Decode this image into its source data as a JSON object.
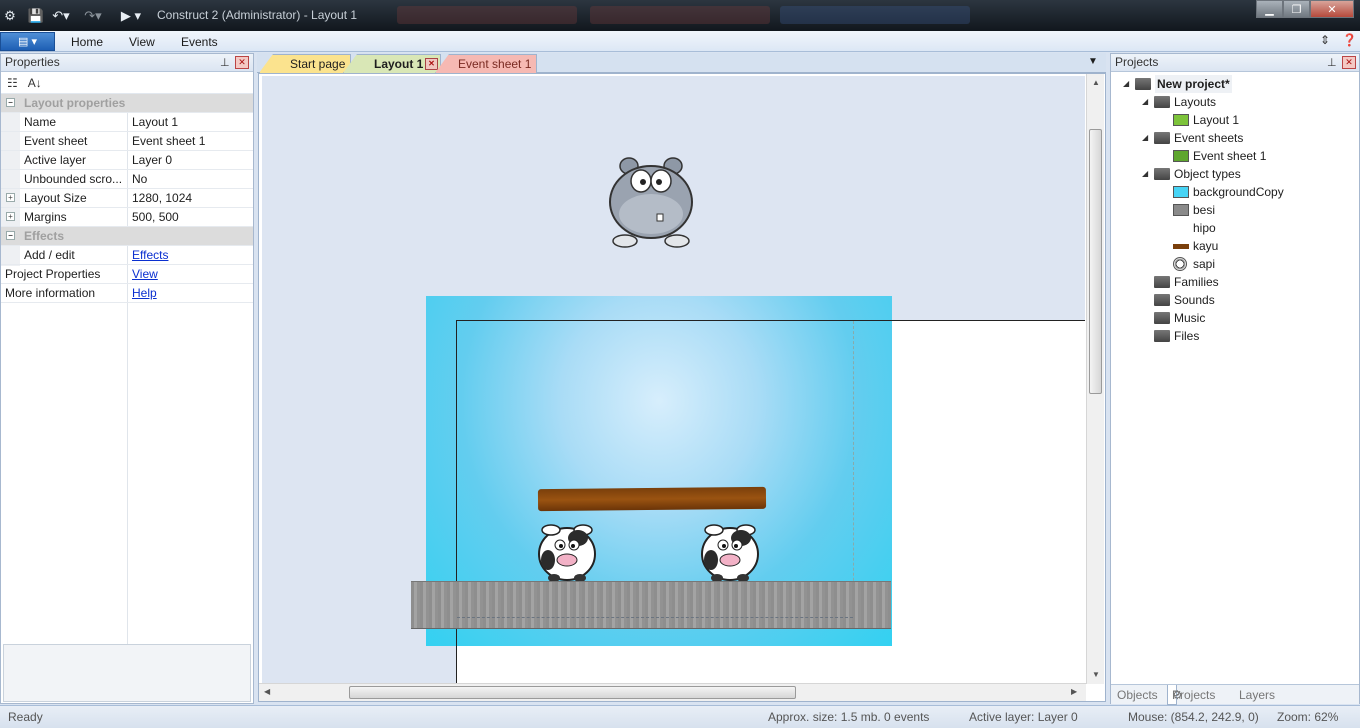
{
  "window": {
    "title": "Construct 2 (Administrator) - Layout 1"
  },
  "ribbon": {
    "tabs": [
      "Home",
      "View",
      "Events"
    ]
  },
  "properties": {
    "title": "Properties",
    "rows": [
      {
        "type": "category",
        "label": "Layout properties"
      },
      {
        "key": "Name",
        "value": "Layout 1"
      },
      {
        "key": "Event sheet",
        "value": "Event sheet 1"
      },
      {
        "key": "Active layer",
        "value": "Layer 0"
      },
      {
        "key": "Unbounded scro...",
        "value": "No"
      },
      {
        "key": "Layout Size",
        "value": "1280, 1024",
        "expandable": true
      },
      {
        "key": "Margins",
        "value": "500, 500",
        "expandable": true
      },
      {
        "type": "category",
        "label": "Effects"
      },
      {
        "key": "Add / edit",
        "value": "Effects",
        "link": true
      },
      {
        "key": "Project Properties",
        "value": "View",
        "link": true,
        "top": true
      },
      {
        "key": "More information",
        "value": "Help",
        "link": true,
        "top": true
      }
    ]
  },
  "doc_tabs": [
    {
      "label": "Start page",
      "color": "#fbe38e"
    },
    {
      "label": "Layout 1",
      "color": "#d9e7b6",
      "active": true
    },
    {
      "label": "Event sheet 1",
      "color": "#f6b9b3"
    }
  ],
  "projects": {
    "title": "Projects",
    "tree": [
      {
        "label": "New project*",
        "level": 0,
        "kind": "project",
        "bold": true
      },
      {
        "label": "Layouts",
        "level": 1,
        "kind": "folder"
      },
      {
        "label": "Layout 1",
        "level": 2,
        "kind": "layout",
        "color": "#7cc33a"
      },
      {
        "label": "Event sheets",
        "level": 1,
        "kind": "folder"
      },
      {
        "label": "Event sheet 1",
        "level": 2,
        "kind": "eventsheet",
        "color": "#5ea62e"
      },
      {
        "label": "Object types",
        "level": 1,
        "kind": "folder"
      },
      {
        "label": "backgroundCopy",
        "level": 2,
        "kind": "swatch",
        "color": "#47d4f5"
      },
      {
        "label": "besi",
        "level": 2,
        "kind": "swatch",
        "color": "#8a8a8a"
      },
      {
        "label": "hipo",
        "level": 2,
        "kind": "none"
      },
      {
        "label": "kayu",
        "level": 2,
        "kind": "swatch",
        "color": "#7a3f0b"
      },
      {
        "label": "sapi",
        "level": 2,
        "kind": "cow"
      },
      {
        "label": "Families",
        "level": 1,
        "kind": "folder"
      },
      {
        "label": "Sounds",
        "level": 1,
        "kind": "folder"
      },
      {
        "label": "Music",
        "level": 1,
        "kind": "folder"
      },
      {
        "label": "Files",
        "level": 1,
        "kind": "folder"
      }
    ],
    "bottom_tabs": [
      "Objects",
      "Projects",
      "Layers"
    ]
  },
  "status": {
    "ready": "Ready",
    "size": "Approx. size: 1.5 mb. 0 events",
    "layer": "Active layer: Layer 0",
    "mouse": "Mouse: (854.2, 242.9, 0)",
    "zoom": "Zoom: 62%"
  }
}
